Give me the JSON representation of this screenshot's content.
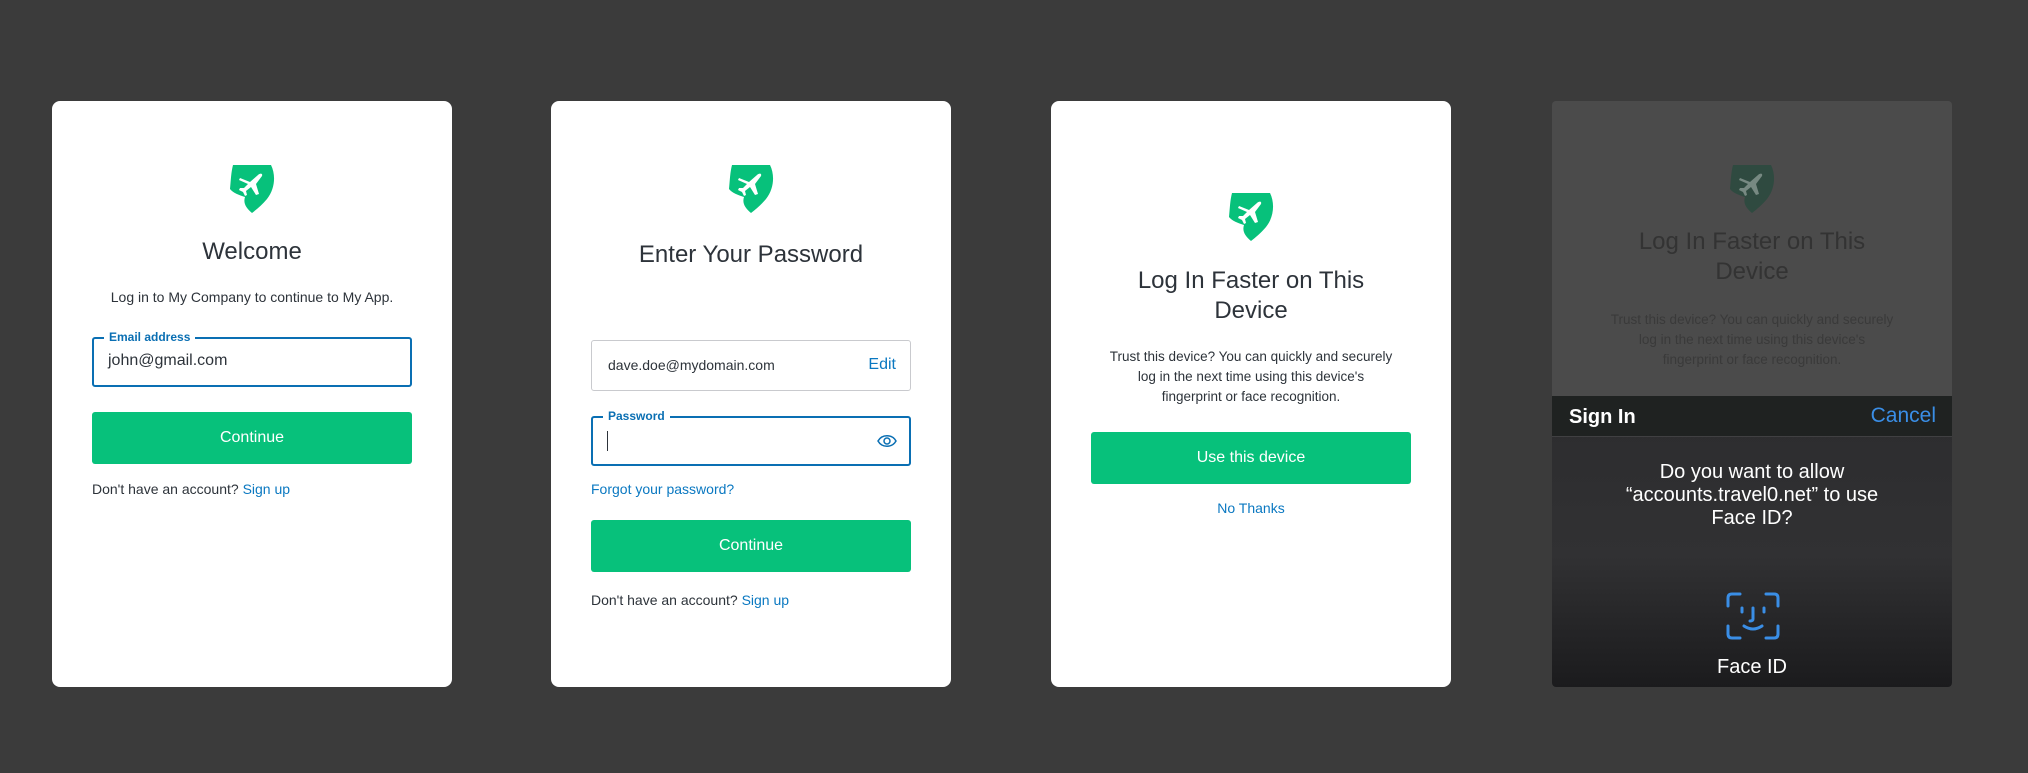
{
  "colors": {
    "background": "#3b3b3b",
    "brand": "#07c17b",
    "link": "#0a78c1",
    "focus": "#0a6fb3",
    "ios_blue": "#3a8ee6"
  },
  "card1": {
    "logo_icon": "airplane-shield-logo",
    "title": "Welcome",
    "subtitle": "Log in to My Company to continue to My App.",
    "email_label": "Email address",
    "email_value": "john@gmail.com",
    "continue_label": "Continue",
    "no_account": "Don't have an account?",
    "signup": "Sign up"
  },
  "card2": {
    "logo_icon": "airplane-shield-logo",
    "title": "Enter Your Password",
    "email_value": "dave.doe@mydomain.com",
    "edit_label": "Edit",
    "password_label": "Password",
    "password_value": "",
    "show_password_icon": "eye-icon",
    "forgot": "Forgot your password?",
    "continue_label": "Continue",
    "no_account": "Don't have an account?",
    "signup": "Sign up"
  },
  "card3": {
    "logo_icon": "airplane-shield-logo",
    "title_line1": "Log In Faster on This",
    "title_line2": "Device",
    "text_line1": "Trust this device? You can quickly and securely",
    "text_line2": "log in the next time using this device's",
    "text_line3": "fingerprint or face recognition.",
    "use_device": "Use this device",
    "no_thanks": "No Thanks"
  },
  "card4": {
    "bg_title_line1": "Log In Faster on This",
    "bg_title_line2": "Device",
    "bg_text_line1": "Trust this device? You can quickly and securely",
    "bg_text_line2": "log in the next time using this device's",
    "bg_text_line3": "fingerprint or face recognition.",
    "sheet_title": "Sign In",
    "cancel": "Cancel",
    "question_line1": "Do you want to allow",
    "question_line2": "“accounts.travel0.net” to use",
    "question_line3": "Face ID?",
    "faceid_icon": "face-id-icon",
    "faceid_label": "Face ID"
  }
}
